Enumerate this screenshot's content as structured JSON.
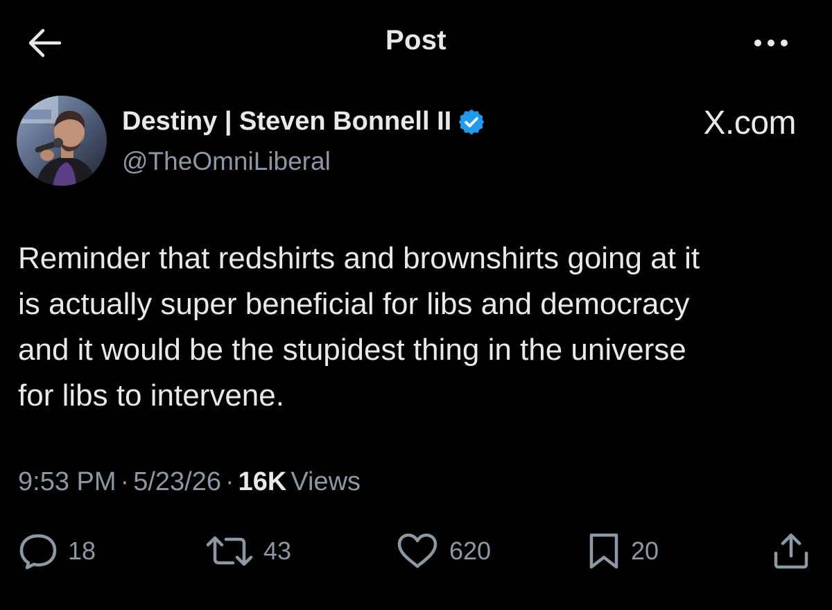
{
  "header": {
    "title": "Post",
    "back_icon": "arrow-left-icon",
    "more_icon": "ellipsis-icon"
  },
  "author": {
    "display_name": "Destiny | Steven Bonnell II",
    "handle": "@TheOmniLiberal",
    "verified": true,
    "verified_color": "#1d9bf0"
  },
  "brand": {
    "label": "X.com"
  },
  "tweet": {
    "text": "Reminder that redshirts and brownshirts going at it\nis actually super beneficial for libs and democracy\nand it would be the stupidest thing in the universe\nfor libs to intervene."
  },
  "meta": {
    "time": "9:53 PM",
    "sep1": "·",
    "date": "5/23/26",
    "sep2": "·",
    "views_count": "16K",
    "views_label": "Views"
  },
  "actions": {
    "replies": "18",
    "reposts": "43",
    "likes": "620",
    "bookmarks": "20"
  },
  "colors": {
    "background": "#000000",
    "text": "#e7e9ea",
    "secondary": "#8b98a5",
    "accent": "#1d9bf0"
  }
}
